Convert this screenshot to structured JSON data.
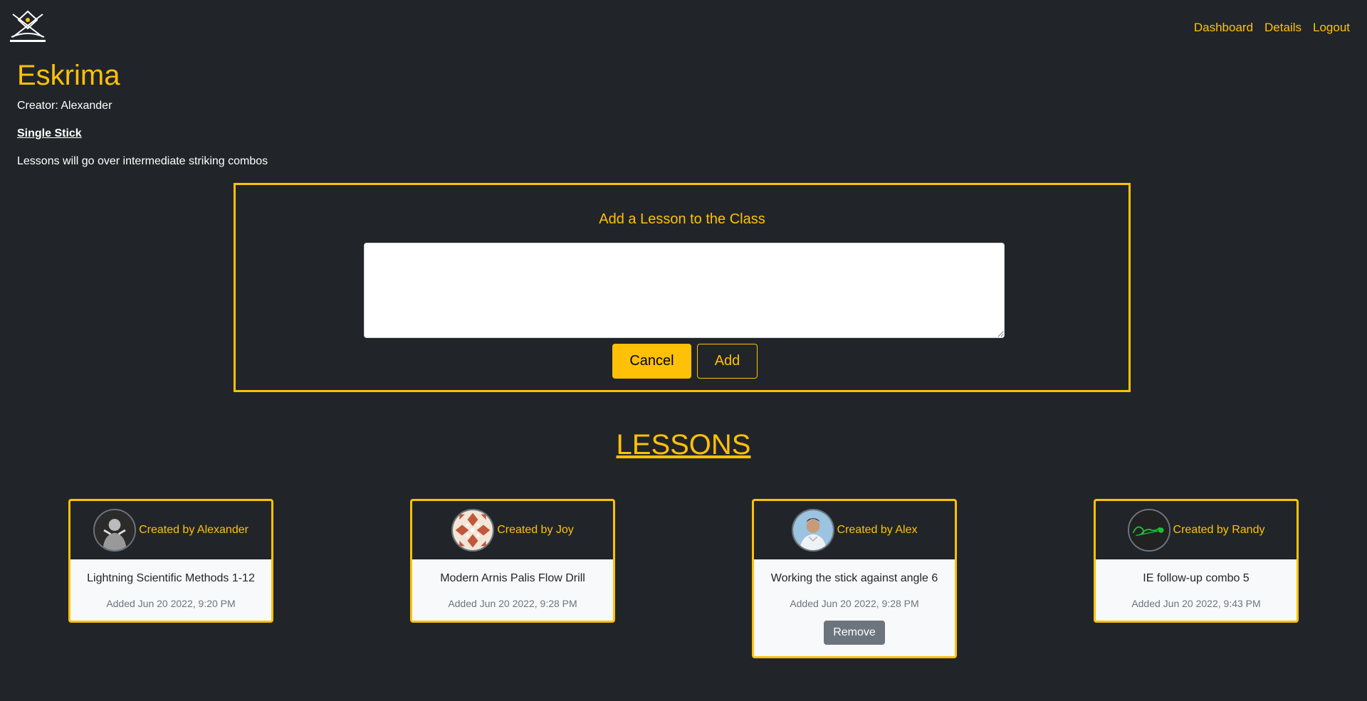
{
  "nav": {
    "dashboard": "Dashboard",
    "details": "Details",
    "logout": "Logout"
  },
  "class": {
    "title": "Eskrima",
    "creator": "Creator: Alexander",
    "style": "Single Stick",
    "description": "Lessons will go over intermediate striking combos"
  },
  "form": {
    "title": "Add a Lesson to the Class",
    "textarea_value": "",
    "cancel_label": "Cancel",
    "add_label": "Add"
  },
  "lessons_heading": "LESSONS",
  "lessons": [
    {
      "creator": "Created by Alexander",
      "name": "Lightning Scientific Methods 1-12",
      "added": "Added Jun 20 2022, 9:20 PM",
      "avatar_icon": "person-portrait-icon"
    },
    {
      "creator": "Created by Joy",
      "name": "Modern Arnis Palis Flow Drill",
      "added": "Added Jun 20 2022, 9:28 PM",
      "avatar_icon": "pattern-avatar-icon"
    },
    {
      "creator": "Created by Alex",
      "name": "Working the stick against angle 6",
      "added": "Added Jun 20 2022, 9:28 PM",
      "avatar_icon": "person-portrait-icon",
      "remove_label": "Remove"
    },
    {
      "creator": "Created by Randy",
      "name": "IE follow-up combo 5",
      "added": "Added Jun 20 2022, 9:43 PM",
      "avatar_icon": "signature-avatar-icon"
    }
  ],
  "colors": {
    "accent": "#ffc107",
    "background": "#212529",
    "card_bg": "#f8f9fa",
    "muted": "#6c757d"
  }
}
